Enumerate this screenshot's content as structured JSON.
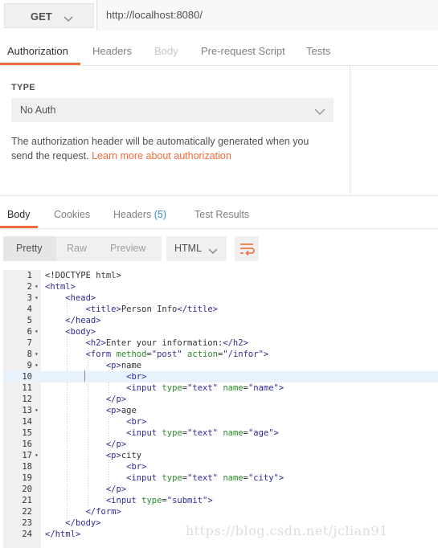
{
  "request": {
    "method": "GET",
    "url": "http://localhost:8080/"
  },
  "request_tabs": [
    {
      "label": "Authorization",
      "state": "active"
    },
    {
      "label": "Headers",
      "state": "normal"
    },
    {
      "label": "Body",
      "state": "disabled"
    },
    {
      "label": "Pre-request Script",
      "state": "normal"
    },
    {
      "label": "Tests",
      "state": "normal"
    }
  ],
  "auth": {
    "type_label": "TYPE",
    "type_value": "No Auth",
    "description": "The authorization header will be automatically generated when you send the request.",
    "link_text": "Learn more about authorization"
  },
  "response_tabs": {
    "body": "Body",
    "cookies": "Cookies",
    "headers": "Headers",
    "headers_count": "(5)",
    "test_results": "Test Results"
  },
  "view": {
    "modes": [
      "Pretty",
      "Raw",
      "Preview"
    ],
    "active_mode": "Pretty",
    "format": "HTML",
    "wrap_icon": "wrap-lines-icon"
  },
  "colors": {
    "accent": "#f26b3a",
    "tag": "#2c2c96",
    "attribute": "#2a8a2a",
    "count": "#2a8ad4"
  },
  "code_lines": [
    {
      "n": "1",
      "text": "<!DOCTYPE html>"
    },
    {
      "n": "2",
      "text": "<html>",
      "fold": true
    },
    {
      "n": "3",
      "text": "    <head>",
      "fold": true
    },
    {
      "n": "4",
      "text": "        <title>Person Info</title>"
    },
    {
      "n": "5",
      "text": "    </head>"
    },
    {
      "n": "6",
      "text": "    <body>",
      "fold": true
    },
    {
      "n": "7",
      "text": "        <h2>Enter your information:</h2>"
    },
    {
      "n": "8",
      "text": "        <form method=\"post\" action=\"/infor\">",
      "fold": true
    },
    {
      "n": "9",
      "text": "            <p>name",
      "fold": true
    },
    {
      "n": "10",
      "text": "                <br>",
      "highlight": true
    },
    {
      "n": "11",
      "text": "                <input type=\"text\" name=\"name\">"
    },
    {
      "n": "12",
      "text": "            </p>"
    },
    {
      "n": "13",
      "text": "            <p>age",
      "fold": true
    },
    {
      "n": "14",
      "text": "                <br>"
    },
    {
      "n": "15",
      "text": "                <input type=\"text\" name=\"age\">"
    },
    {
      "n": "16",
      "text": "            </p>"
    },
    {
      "n": "17",
      "text": "            <p>city",
      "fold": true
    },
    {
      "n": "18",
      "text": "                <br>"
    },
    {
      "n": "19",
      "text": "                <input type=\"text\" name=\"city\">"
    },
    {
      "n": "20",
      "text": "            </p>"
    },
    {
      "n": "21",
      "text": "            <input type=\"submit\">"
    },
    {
      "n": "22",
      "text": "        </form>"
    },
    {
      "n": "23",
      "text": "    </body>"
    },
    {
      "n": "24",
      "text": "</html>"
    }
  ],
  "watermark": "https://blog.csdn.net/jclian91"
}
